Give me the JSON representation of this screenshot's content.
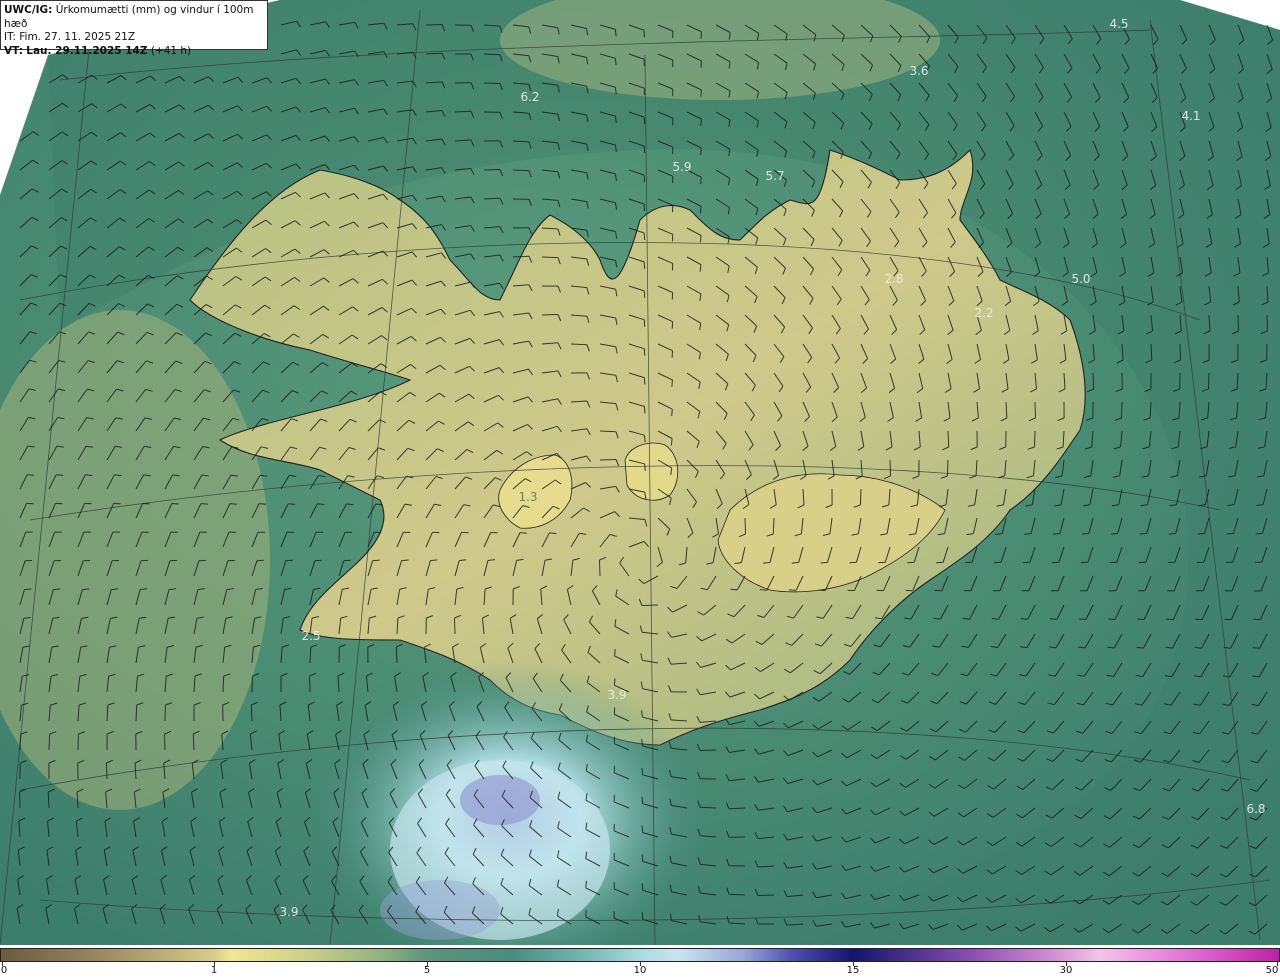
{
  "header": {
    "model": "UWC/IG:",
    "title": "Úrkomumætti (mm) og vindur í 100m hæð",
    "init_label": "IT:",
    "init_time": "Fim. 27. 11. 2025 21Z",
    "valid_label": "VT:",
    "valid_time": "Lau. 29.11.2025 14Z",
    "lead": "(+41 h)"
  },
  "map_labels": [
    {
      "text": "4.5"
    },
    {
      "text": "3.6"
    },
    {
      "text": "4.1"
    },
    {
      "text": "6.2"
    },
    {
      "text": "5.9"
    },
    {
      "text": "5.7"
    },
    {
      "text": "2.8"
    },
    {
      "text": "5.0"
    },
    {
      "text": "2.2"
    },
    {
      "text": "1.3"
    },
    {
      "text": "2.5"
    },
    {
      "text": "3.9"
    },
    {
      "text": "6.8"
    },
    {
      "text": "3.9"
    }
  ],
  "colorbar": {
    "ticks": [
      "0",
      "1",
      "5",
      "10",
      "15",
      "30",
      "50"
    ]
  },
  "colors": {
    "dry": "#d9cc88",
    "moderate": "#5e957b",
    "wet": "#a8dbe0",
    "heavy": "#13146e",
    "extreme": "#bf1fa8"
  }
}
